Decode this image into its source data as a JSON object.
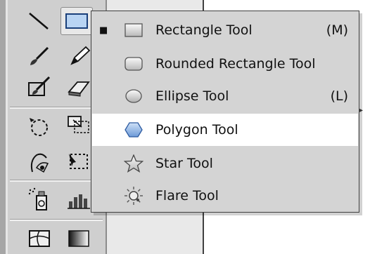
{
  "menu": {
    "items": [
      {
        "label": "Rectangle Tool",
        "shortcut": "(M)",
        "icon": "rectangle-icon",
        "checked": true
      },
      {
        "label": "Rounded Rectangle Tool",
        "shortcut": "",
        "icon": "rounded-rectangle-icon",
        "checked": false
      },
      {
        "label": "Ellipse Tool",
        "shortcut": "(L)",
        "icon": "ellipse-icon",
        "checked": false
      },
      {
        "label": "Polygon Tool",
        "shortcut": "",
        "icon": "polygon-icon",
        "checked": false,
        "hovered": true
      },
      {
        "label": "Star Tool",
        "shortcut": "",
        "icon": "star-icon",
        "checked": false
      },
      {
        "label": "Flare Tool",
        "shortcut": "",
        "icon": "flare-icon",
        "checked": false
      }
    ],
    "check_glyph": "■"
  },
  "toolbar": {
    "tools": [
      "line-segment-icon",
      "rectangle-icon",
      "paintbrush-icon",
      "pencil-icon",
      "blob-brush-icon",
      "eraser-icon",
      "rotate-icon",
      "scale-icon",
      "warp-icon",
      "free-transform-icon",
      "symbol-sprayer-icon",
      "column-graph-icon",
      "mesh-icon",
      "gradient-icon"
    ]
  },
  "colors": {
    "hover": "#ffffff",
    "menu_bg": "#d4d4d4",
    "panel_bg": "#cfcfcf",
    "polygon_fill": "#8fb6e8"
  }
}
